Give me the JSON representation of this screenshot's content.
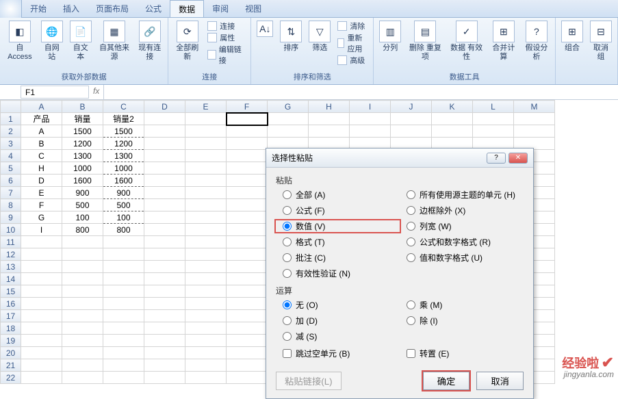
{
  "tabs": {
    "start": "开始",
    "insert": "插入",
    "layout": "页面布局",
    "formula": "公式",
    "data": "数据",
    "review": "审阅",
    "view": "视图"
  },
  "ribbon": {
    "ext": {
      "access": "自 Access",
      "web": "自网站",
      "text": "自文本",
      "other": "自其他来源",
      "existing": "现有连接",
      "label": "获取外部数据"
    },
    "conn": {
      "refresh": "全部刷新",
      "link": "连接",
      "prop": "属性",
      "edit": "编辑链接",
      "label": "连接"
    },
    "sort": {
      "sort": "排序",
      "filter": "筛选",
      "clear": "清除",
      "reapply": "重新应用",
      "advanced": "高级",
      "label": "排序和筛选"
    },
    "tools": {
      "split": "分列",
      "dup": "删除\n重复项",
      "valid": "数据\n有效性",
      "consol": "合并计算",
      "whatif": "假设分析",
      "label": "数据工具"
    },
    "outline": {
      "group": "组合",
      "ungroup": "取消组"
    }
  },
  "namebox": "F1",
  "columns": [
    "A",
    "B",
    "C",
    "D",
    "E",
    "F",
    "G",
    "H",
    "I",
    "J",
    "K",
    "L",
    "M"
  ],
  "table_data": {
    "headers": [
      "产品",
      "销量",
      "销量2"
    ],
    "rows": [
      [
        "A",
        "1500",
        "1500"
      ],
      [
        "B",
        "1200",
        "1200"
      ],
      [
        "C",
        "1300",
        "1300"
      ],
      [
        "H",
        "1000",
        "1000"
      ],
      [
        "D",
        "1600",
        "1600"
      ],
      [
        "E",
        "900",
        "900"
      ],
      [
        "F",
        "500",
        "500"
      ],
      [
        "G",
        "100",
        "100"
      ],
      [
        "I",
        "800",
        "800"
      ]
    ]
  },
  "dialog": {
    "title": "选择性粘贴",
    "paste_label": "粘贴",
    "paste_opts_left": [
      {
        "key": "all",
        "label": "全部 (A)"
      },
      {
        "key": "formula",
        "label": "公式 (F)"
      },
      {
        "key": "value",
        "label": "数值 (V)"
      },
      {
        "key": "format",
        "label": "格式 (T)"
      },
      {
        "key": "comment",
        "label": "批注 (C)"
      },
      {
        "key": "valid",
        "label": "有效性验证 (N)"
      }
    ],
    "paste_opts_right": [
      {
        "key": "theme",
        "label": "所有使用源主题的单元 (H)"
      },
      {
        "key": "border",
        "label": "边框除外 (X)"
      },
      {
        "key": "colw",
        "label": "列宽 (W)"
      },
      {
        "key": "numfmt",
        "label": "公式和数字格式 (R)"
      },
      {
        "key": "valnum",
        "label": "值和数字格式 (U)"
      }
    ],
    "op_label": "运算",
    "op_left": [
      {
        "key": "none",
        "label": "无 (O)"
      },
      {
        "key": "add",
        "label": "加 (D)"
      },
      {
        "key": "sub",
        "label": "减 (S)"
      }
    ],
    "op_right": [
      {
        "key": "mul",
        "label": "乘 (M)"
      },
      {
        "key": "div",
        "label": "除 (I)"
      }
    ],
    "skip": "跳过空单元 (B)",
    "transpose": "转置 (E)",
    "pastelink": "粘贴链接(L)",
    "ok": "确定",
    "cancel": "取消"
  },
  "watermark": {
    "t1": "经验啦",
    "t2": "jingyanla.com"
  }
}
